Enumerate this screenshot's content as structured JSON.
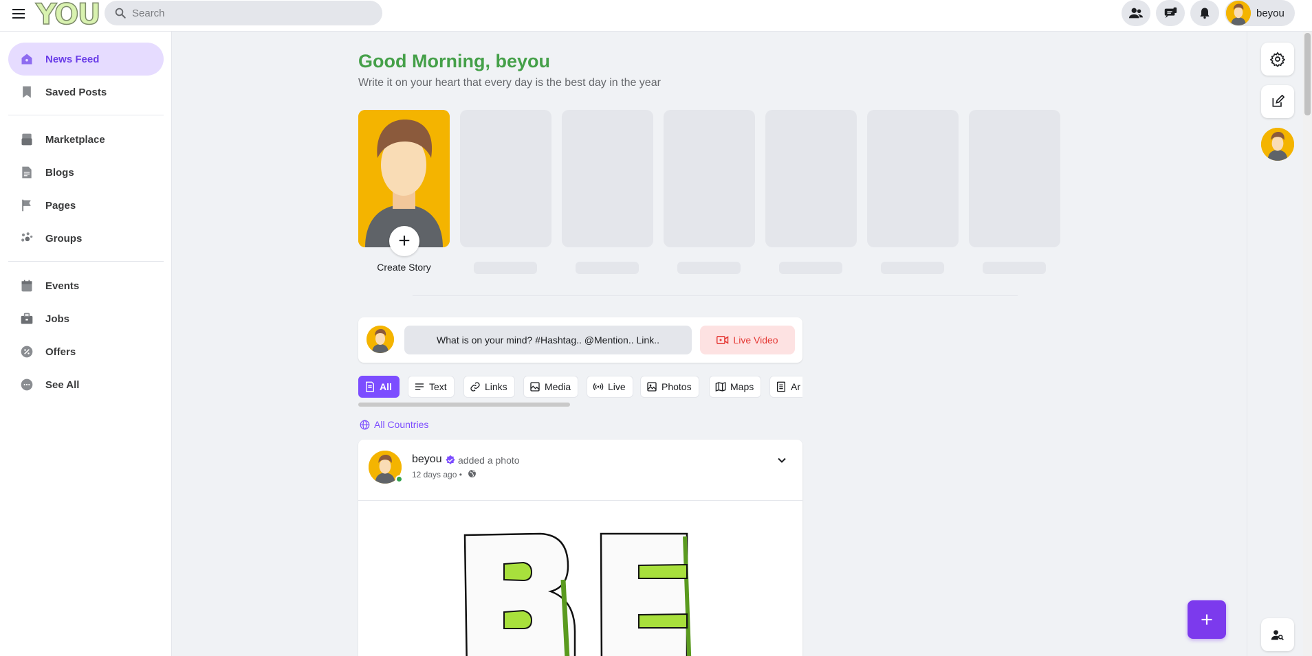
{
  "header": {
    "logo_text": "YOU",
    "search_placeholder": "Search",
    "username": "beyou"
  },
  "sidebar": {
    "items": [
      {
        "label": "News Feed",
        "icon": "home-icon",
        "active": true
      },
      {
        "label": "Saved Posts",
        "icon": "bookmark-icon"
      },
      {
        "label": "Marketplace",
        "icon": "store-icon"
      },
      {
        "label": "Blogs",
        "icon": "blog-icon"
      },
      {
        "label": "Pages",
        "icon": "flag-icon"
      },
      {
        "label": "Groups",
        "icon": "group-icon"
      },
      {
        "label": "Events",
        "icon": "calendar-icon"
      },
      {
        "label": "Jobs",
        "icon": "briefcase-icon"
      },
      {
        "label": "Offers",
        "icon": "offer-icon"
      },
      {
        "label": "See All",
        "icon": "more-icon"
      }
    ]
  },
  "greeting": {
    "title": "Good Morning, beyou",
    "subtitle": "Write it on your heart that every day is the best day in the year"
  },
  "stories": {
    "create_label": "Create Story"
  },
  "composer": {
    "placeholder": "What is on your mind? #Hashtag.. @Mention.. Link..",
    "live_label": "Live Video"
  },
  "filters": [
    {
      "label": "All",
      "active": true
    },
    {
      "label": "Text"
    },
    {
      "label": "Links"
    },
    {
      "label": "Media"
    },
    {
      "label": "Live"
    },
    {
      "label": "Photos"
    },
    {
      "label": "Maps"
    },
    {
      "label": "Ar"
    }
  ],
  "countries_label": "All Countries",
  "post": {
    "author": "beyou",
    "action": "added a photo",
    "time": "12 days ago •"
  },
  "colors": {
    "accent": "#7c4dff",
    "greeting": "#45a049",
    "live": "#e53935"
  }
}
